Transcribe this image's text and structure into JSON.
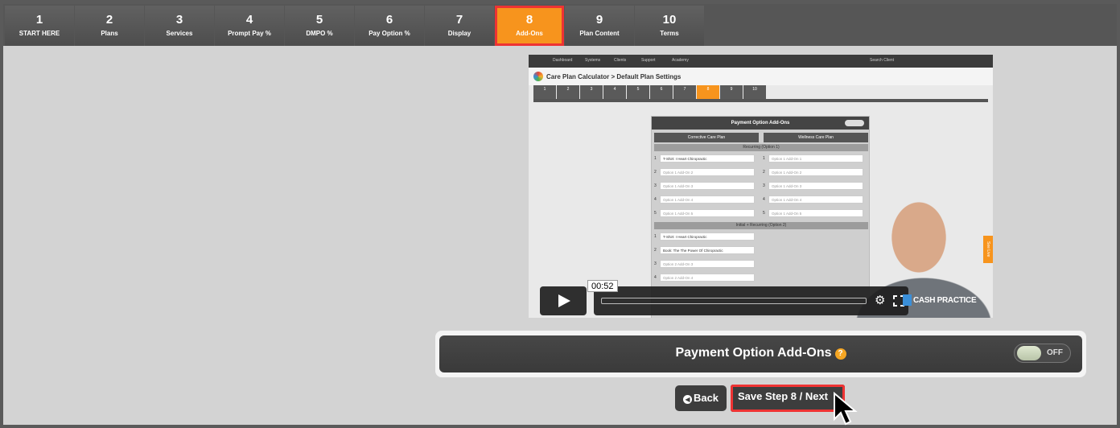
{
  "steps": [
    {
      "num": "1",
      "label": "START HERE"
    },
    {
      "num": "2",
      "label": "Plans"
    },
    {
      "num": "3",
      "label": "Services"
    },
    {
      "num": "4",
      "label": "Prompt Pay %"
    },
    {
      "num": "5",
      "label": "DMPO %"
    },
    {
      "num": "6",
      "label": "Pay Option %"
    },
    {
      "num": "7",
      "label": "Display"
    },
    {
      "num": "8",
      "label": "Add-Ons"
    },
    {
      "num": "9",
      "label": "Plan Content"
    },
    {
      "num": "10",
      "label": "Terms"
    }
  ],
  "active_step": "8",
  "video": {
    "nav": [
      "Dashboard",
      "Systems",
      "Clients",
      "Support",
      "Academy"
    ],
    "search": "Search Client",
    "title": "Care Plan Calculator > Default Plan Settings",
    "panel_title": "Payment Option Add-Ons",
    "col1": "Corrective Care Plan",
    "col2": "Wellness Care Plan",
    "section1": "Recurring (Option 1)",
    "section2": "Initial + Recurring (Option 2)",
    "rows_left_1": [
      "T-Shirt: I Heart Chiropractic",
      "Option 1 Add-On 2",
      "Option 1 Add-On 3",
      "Option 1 Add-On 4",
      "Option 1 Add-On 5"
    ],
    "rows_right_1": [
      "Option 1 Add-On 1",
      "Option 1 Add-On 2",
      "Option 1 Add-On 3",
      "Option 1 Add-On 4",
      "Option 1 Add-On 5"
    ],
    "rows_left_2": [
      "T-Shirt: I Heart Chiropractic",
      "Book: The The Power Of Chiropractic",
      "Option 2 Add-On 3",
      "Option 2 Add-On 4"
    ],
    "side_tab": "See Live",
    "time": "00:52",
    "progress": 0.0,
    "brand": "CASH PRACTICE"
  },
  "addon": {
    "title": "Payment Option Add-Ons",
    "help": "?",
    "toggle_label": "OFF",
    "toggle_on": false
  },
  "buttons": {
    "back": "Back",
    "save": "Save Step 8 / Next"
  },
  "colors": {
    "active_step": "#f7941d",
    "highlight": "#e33333",
    "help": "#f5a623"
  }
}
